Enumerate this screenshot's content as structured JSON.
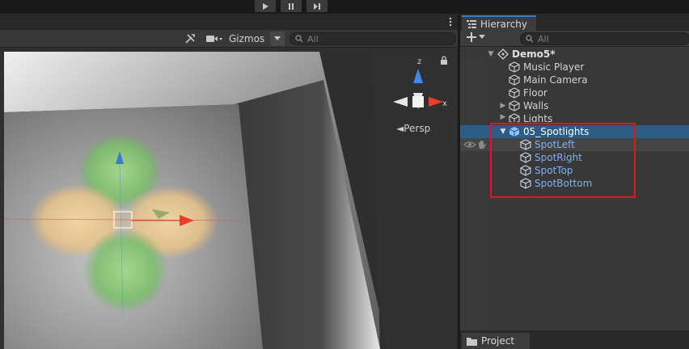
{
  "scene_view": {
    "gizmos_label": "Gizmos",
    "search_placeholder": "All",
    "persp_label": "Persp",
    "axis_z": "z",
    "axis_x": "x"
  },
  "hierarchy": {
    "tab_label": "Hierarchy",
    "search_placeholder": "All",
    "items": [
      {
        "label": "Demo5*"
      },
      {
        "label": "Music Player"
      },
      {
        "label": "Main Camera"
      },
      {
        "label": "Floor"
      },
      {
        "label": "Walls"
      },
      {
        "label": "Lights"
      },
      {
        "label": "05_Spotlights"
      },
      {
        "label": "SpotLeft"
      },
      {
        "label": "SpotRight"
      },
      {
        "label": "SpotTop"
      },
      {
        "label": "SpotBottom"
      }
    ]
  },
  "project": {
    "tab_label": "Project"
  },
  "colors": {
    "selection": "#2c5d87",
    "prefab_text": "#7fb2ef",
    "highlight": "#e8121b",
    "tab_accent": "#3a79bb"
  }
}
